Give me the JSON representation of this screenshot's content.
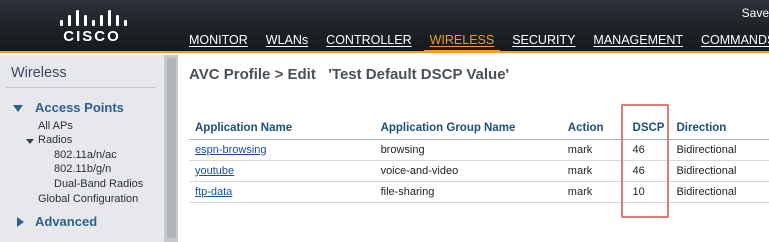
{
  "header": {
    "brand": "CISCO",
    "user_link": "Save",
    "nav": [
      "MONITOR",
      "WLANs",
      "CONTROLLER",
      "WIRELESS",
      "SECURITY",
      "MANAGEMENT",
      "COMMANDS"
    ],
    "active_nav": "WIRELESS",
    "accent_color": "#f79a1e"
  },
  "sidebar": {
    "title": "Wireless",
    "sections": [
      {
        "label": "Access Points",
        "expanded": true
      },
      {
        "label": "Advanced",
        "expanded": false
      }
    ],
    "items": {
      "all_aps": "All APs",
      "radios": "Radios",
      "radio_a": "802.11a/n/ac",
      "radio_b": "802.11b/g/n",
      "dual_band": "Dual-Band Radios",
      "global_config": "Global Configuration"
    }
  },
  "main": {
    "title": "AVC Profile > Edit   'Test Default DSCP Value'",
    "columns": [
      "Application Name",
      "Application Group Name",
      "Action",
      "DSCP",
      "Direction"
    ],
    "rows": [
      {
        "app": "espn-browsing",
        "group": "browsing",
        "action": "mark",
        "dscp": "46",
        "direction": "Bidirectional"
      },
      {
        "app": "youtube",
        "group": "voice-and-video",
        "action": "mark",
        "dscp": "46",
        "direction": "Bidirectional"
      },
      {
        "app": "ftp-data",
        "group": "file-sharing",
        "action": "mark",
        "dscp": "10",
        "direction": "Bidirectional"
      }
    ],
    "highlight_color": "#e07a72"
  }
}
